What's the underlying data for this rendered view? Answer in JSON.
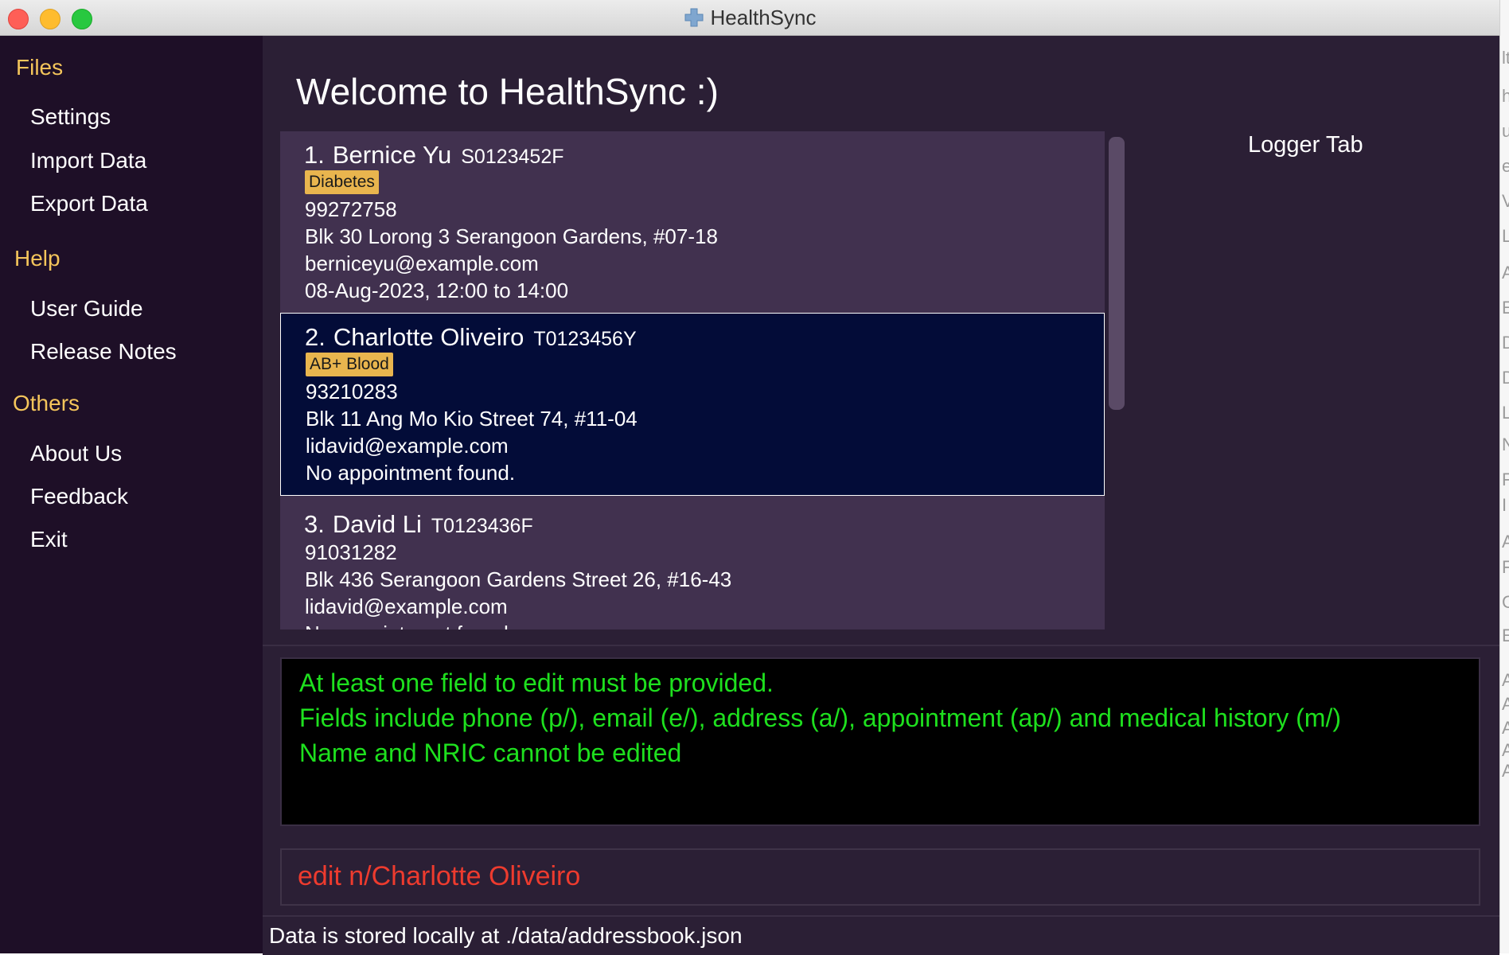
{
  "window": {
    "title": "HealthSync",
    "icon": "medical-cross-icon",
    "traffic_lights": [
      "close",
      "minimize",
      "maximize"
    ]
  },
  "sidebar": {
    "sections": [
      {
        "heading": "Files",
        "items": [
          "Settings",
          "Import Data",
          "Export Data"
        ]
      },
      {
        "heading": "Help",
        "items": [
          "User Guide",
          "Release Notes"
        ]
      },
      {
        "heading": "Others",
        "items": [
          "About Us",
          "Feedback",
          "Exit"
        ]
      }
    ]
  },
  "main": {
    "welcome": "Welcome to HealthSync :)",
    "logger_tab": "Logger Tab"
  },
  "patients": [
    {
      "index": "1.",
      "name": "Bernice Yu",
      "nric": "S0123452F",
      "tag": "Diabetes",
      "phone": "99272758",
      "address": "Blk 30 Lorong 3 Serangoon Gardens, #07-18",
      "email": "berniceyu@example.com",
      "appointment": "08-Aug-2023, 12:00 to 14:00",
      "selected": false
    },
    {
      "index": "2.",
      "name": "Charlotte Oliveiro",
      "nric": "T0123456Y",
      "tag": "AB+ Blood",
      "phone": "93210283",
      "address": "Blk 11 Ang Mo Kio Street 74, #11-04",
      "email": "lidavid@example.com",
      "appointment": "No appointment found.",
      "selected": true
    },
    {
      "index": "3.",
      "name": "David Li",
      "nric": "T0123436F",
      "tag": "",
      "phone": "91031282",
      "address": "Blk 436 Serangoon Gardens Street 26, #16-43",
      "email": "lidavid@example.com",
      "appointment": "No appointment found.",
      "selected": false
    }
  ],
  "result": {
    "lines": [
      "At least one field to edit must be provided.",
      "Fields include phone (p/), email (e/), address (a/), appointment (ap/) and medical history (m/)",
      "Name and NRIC cannot be edited"
    ]
  },
  "command": {
    "value": "edit n/Charlotte Oliveiro"
  },
  "status": {
    "text": "Data is stored locally at ./data/addressbook.json"
  },
  "background_window_glyphs": [
    "lt",
    "h",
    "u",
    "ea",
    "V",
    "L",
    "A",
    "E",
    "D",
    "D",
    "L",
    "N",
    "F",
    "I",
    "A",
    "F",
    "C",
    "E",
    "AF",
    "AF",
    "AF",
    "AF",
    "AF"
  ],
  "colors": {
    "sidebar_bg": "#1e0f27",
    "main_bg": "#2b1f35",
    "card_bg": "#41314f",
    "selected_card_bg": "#030c38",
    "heading_accent": "#f4c55b",
    "tag_bg": "#e9b54e",
    "result_text": "#1ee01e",
    "command_text": "#ee3b2e"
  }
}
